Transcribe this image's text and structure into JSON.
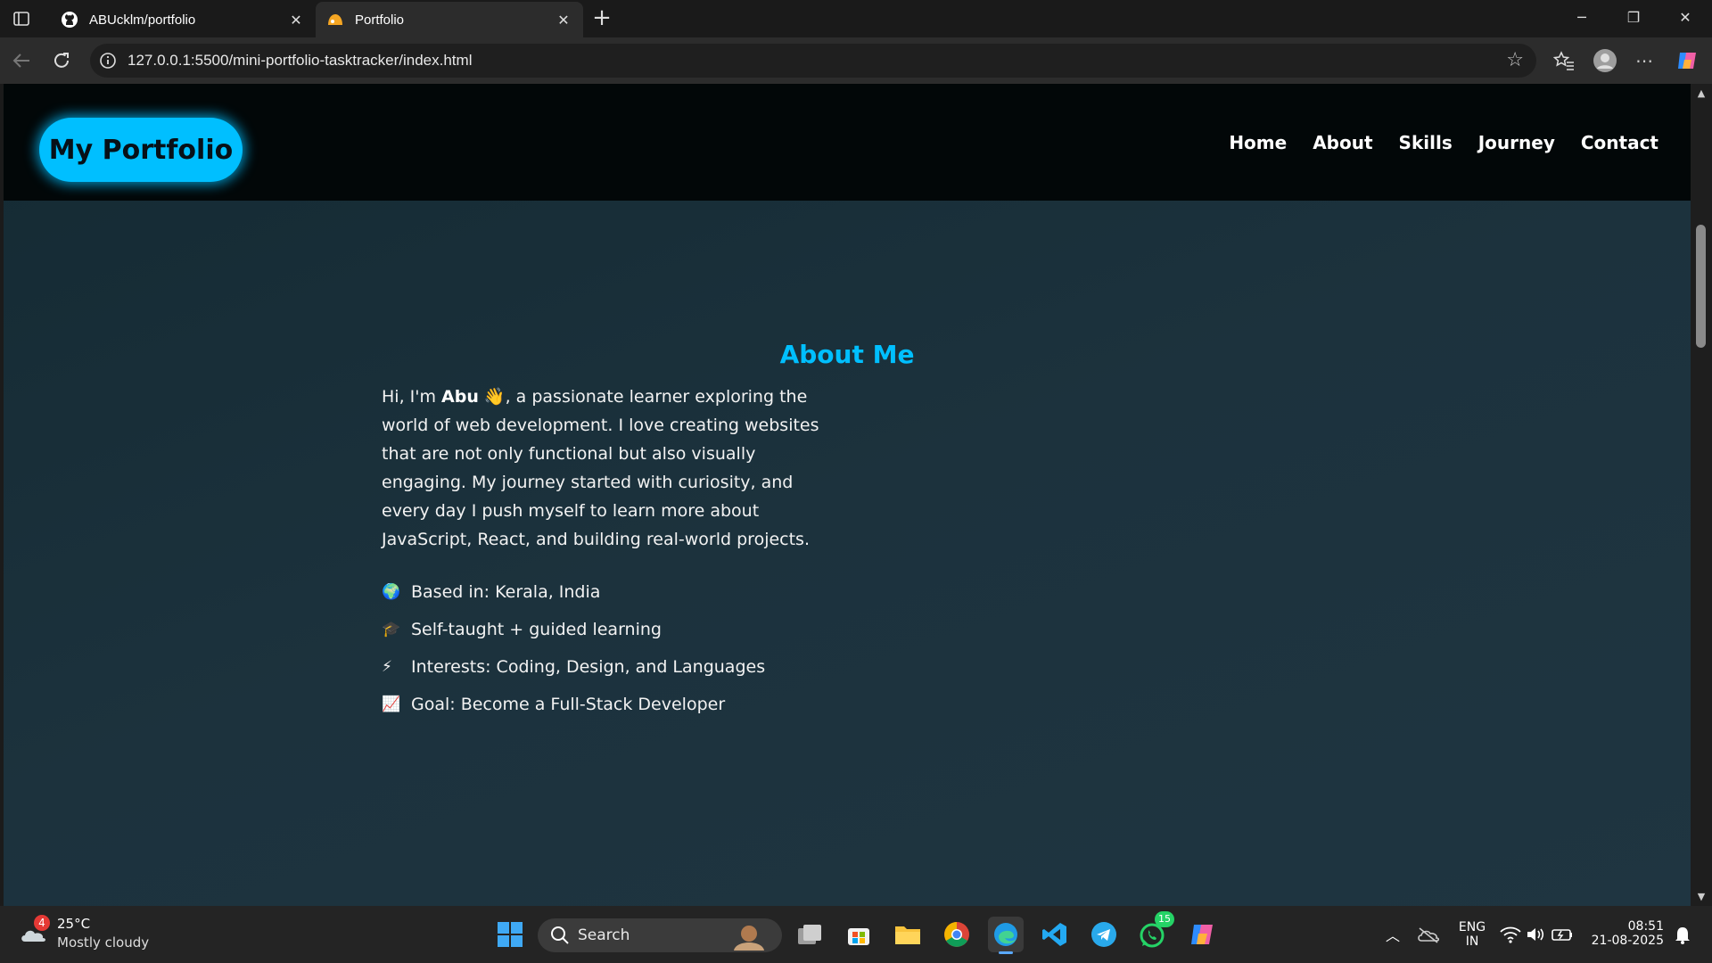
{
  "browser": {
    "tabs": [
      {
        "title": "ABUcklm/portfolio",
        "close": "✕"
      },
      {
        "title": "Portfolio",
        "close": "✕"
      }
    ],
    "new_tab": "+",
    "window_controls": {
      "minimize": "─",
      "restore": "❐",
      "close": "✕"
    },
    "url": "127.0.0.1:5500/mini-portfolio-tasktracker/index.html",
    "toolbar_more": "⋯"
  },
  "site": {
    "logo": "My Portfolio",
    "nav": [
      "Home",
      "About",
      "Skills",
      "Journey",
      "Contact"
    ],
    "about": {
      "title": "About Me",
      "intro_pre": "Hi, I'm ",
      "name": "Abu",
      "wave": " 👋",
      "intro_post": ", a passionate learner exploring the world of web development. I love creating websites that are not only functional but also visually engaging. My journey started with curiosity, and every day I push myself to learn more about JavaScript, React, and building real-world projects.",
      "facts": [
        {
          "icon": "🌍",
          "text": "Based in: Kerala, India"
        },
        {
          "icon": "🎓",
          "text": "Self-taught + guided learning"
        },
        {
          "icon": "⚡",
          "text": "Interests: Coding, Design, and Languages"
        },
        {
          "icon": "📈",
          "text": "Goal: Become a Full-Stack Developer"
        }
      ]
    }
  },
  "taskbar": {
    "weather": {
      "badge": "4",
      "temp": "25°C",
      "condition": "Mostly cloudy"
    },
    "search_label": "Search",
    "whatsapp_badge": "15",
    "language": {
      "line1": "ENG",
      "line2": "IN"
    },
    "clock": {
      "time": "08:51",
      "date": "21-08-2025"
    }
  },
  "colors": {
    "accent": "#00bfff",
    "header_bg": "#020708",
    "page_bg": "#1c323d"
  }
}
